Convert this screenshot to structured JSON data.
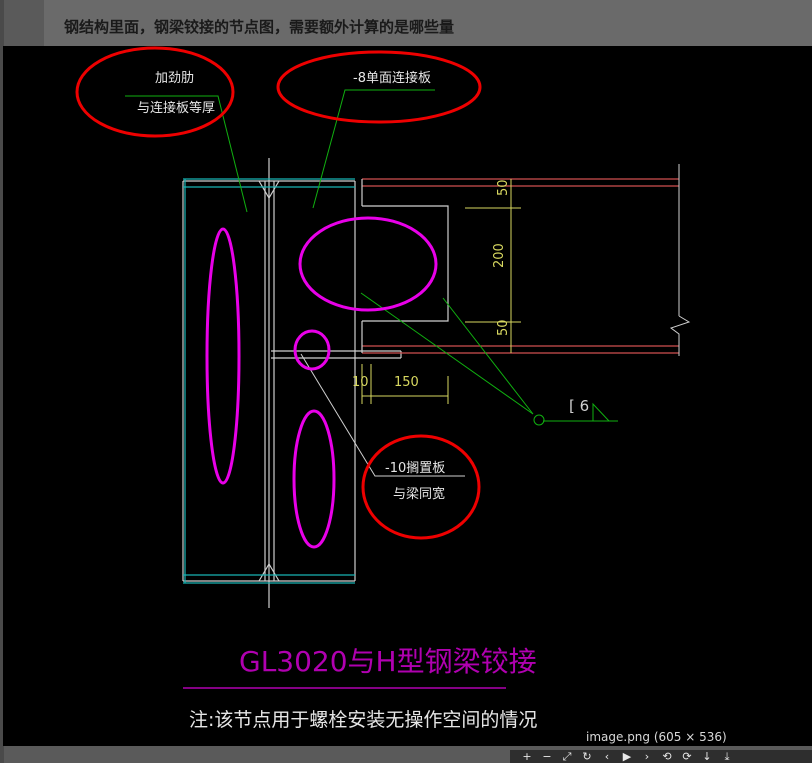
{
  "question": "钢结构里面，钢梁铰接的节点图，需要额外计算的是哪些量",
  "drawing": {
    "callout_stiffener_line1": "加劲肋",
    "callout_stiffener_line2": "与连接板等厚",
    "callout_plate": "-8单面连接板",
    "callout_seat_line1": "-10搁置板",
    "callout_seat_line2": "与梁同宽",
    "dim_top": "50",
    "dim_middle": "200",
    "dim_bottom": "50",
    "dim_gap": "10",
    "dim_width": "150",
    "weld_size": "6",
    "title": "GL3020与H型钢梁铰接",
    "note": "注:该节点用于螺栓安装无操作空间的情况"
  },
  "image_caption": "image.png (605 × 536)",
  "toolbar": {
    "icons": [
      "+",
      "−",
      "⤢",
      "↻",
      "‹",
      "▶",
      "›",
      "⟲",
      "⟳",
      "↓",
      "⤓"
    ]
  },
  "colors": {
    "cad_background": "#000000",
    "column": "#cfcfcf",
    "cyan_edge": "#18b4b4",
    "beam_flange": "#d05050",
    "dimension": "#d8d860",
    "leader": "#10b010",
    "highlight_ellipse": "#e800e8",
    "annotation_circle": "#ee0000",
    "title": "#b000b0"
  }
}
